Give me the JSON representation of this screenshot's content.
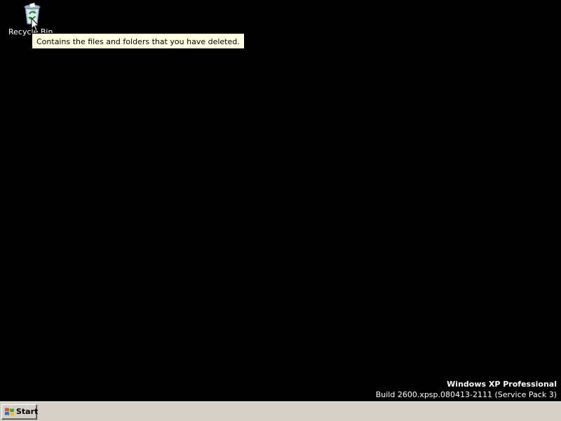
{
  "desktop": {
    "background_color": "#000000",
    "icons": [
      {
        "label": "Recycle Bin",
        "icon": "recycle-bin-icon"
      }
    ],
    "tooltip": {
      "text": "Contains the files and folders that you have deleted."
    }
  },
  "version_info": {
    "edition": "Windows XP Professional",
    "build": "Build 2600.xpsp.080413-2111 (Service Pack 3)"
  },
  "taskbar": {
    "start_label": "Start",
    "start_icon": "windows-flag-icon",
    "background_color": "#d4d0c8"
  }
}
